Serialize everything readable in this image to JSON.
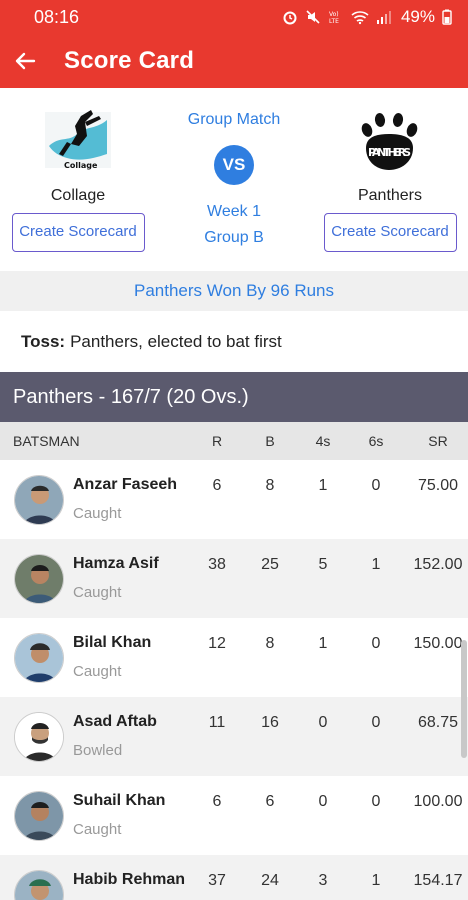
{
  "status": {
    "time": "08:16",
    "battery": "49%"
  },
  "appbar": {
    "title": "Score Card"
  },
  "match": {
    "team_left": {
      "name": "Collage",
      "logo_text": "Collage",
      "create_label": "Create Scorecard"
    },
    "team_right": {
      "name": "Panthers",
      "logo_text": "PANTHERS",
      "create_label": "Create Scorecard"
    },
    "match_type": "Group Match",
    "vs": "VS",
    "week": "Week 1",
    "group": "Group B"
  },
  "result": "Panthers Won By 96 Runs",
  "toss": {
    "label": "Toss:",
    "text": "Panthers, elected to bat first"
  },
  "innings": {
    "title": "Panthers - 167/7 (20 Ovs.)"
  },
  "table": {
    "headers": [
      "BATSMAN",
      "R",
      "B",
      "4s",
      "6s",
      "SR"
    ],
    "rows": [
      {
        "name": "Anzar Faseeh",
        "out": "Caught",
        "r": "6",
        "b": "8",
        "fours": "1",
        "sixes": "0",
        "sr": "75.00"
      },
      {
        "name": "Hamza Asif",
        "out": "Caught",
        "r": "38",
        "b": "25",
        "fours": "5",
        "sixes": "1",
        "sr": "152.00"
      },
      {
        "name": "Bilal Khan",
        "out": "Caught",
        "r": "12",
        "b": "8",
        "fours": "1",
        "sixes": "0",
        "sr": "150.00"
      },
      {
        "name": "Asad Aftab",
        "out": "Bowled",
        "r": "11",
        "b": "16",
        "fours": "0",
        "sixes": "0",
        "sr": "68.75"
      },
      {
        "name": "Suhail Khan",
        "out": "Caught",
        "r": "6",
        "b": "6",
        "fours": "0",
        "sixes": "0",
        "sr": "100.00"
      },
      {
        "name": "Habib Rehman",
        "out": "",
        "r": "37",
        "b": "24",
        "fours": "3",
        "sixes": "1",
        "sr": "154.17"
      }
    ]
  },
  "colors": {
    "accent": "#e8392f",
    "link": "#2f7ee0",
    "innings_bar": "#5b5a6e"
  }
}
